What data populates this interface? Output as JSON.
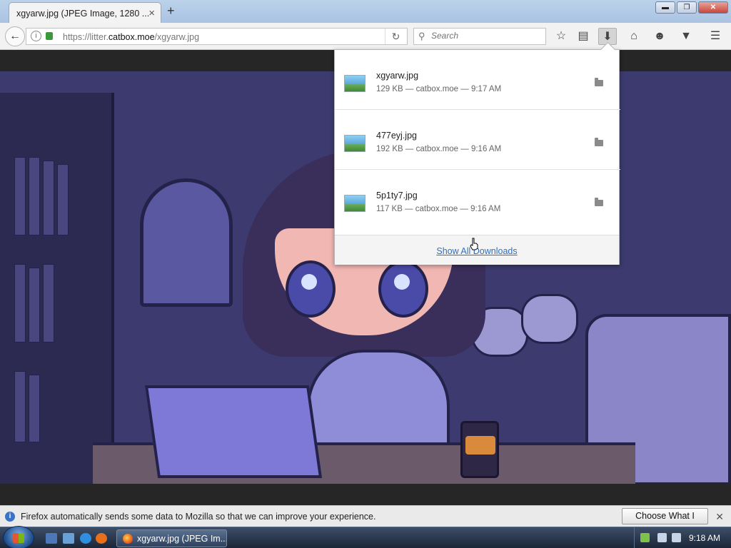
{
  "tab": {
    "title": "xgyarw.jpg (JPEG Image, 1280 ...",
    "close_glyph": "×"
  },
  "newtab_glyph": "+",
  "window_controls": {
    "minimize": "▬",
    "maximize": "❐",
    "close": "✕"
  },
  "nav": {
    "url_host_prefix": "https://litter.",
    "url_domain": "catbox.moe",
    "url_path": "/xgyarw.jpg",
    "search_placeholder": "Search",
    "icons": [
      "back-arrow-icon",
      "info-icon",
      "lock-icon",
      "reload-icon",
      "search-icon",
      "bookmark-star-icon",
      "reading-list-icon",
      "downloads-icon",
      "home-icon",
      "hello-chat-icon",
      "pocket-icon",
      "menu-icon"
    ]
  },
  "downloads": {
    "items": [
      {
        "name": "xgyarw.jpg",
        "meta": "129 KB — catbox.moe — 9:17 AM"
      },
      {
        "name": "477eyj.jpg",
        "meta": "192 KB — catbox.moe — 9:16 AM"
      },
      {
        "name": "5p1ty7.jpg",
        "meta": "117 KB — catbox.moe — 9:16 AM"
      }
    ],
    "show_all": "Show All Downloads"
  },
  "notification": {
    "text": "Firefox automatically sends some data to Mozilla so that we can improve your experience.",
    "button": "Choose What I Share",
    "close_glyph": "✕",
    "info_glyph": "i"
  },
  "taskbar": {
    "active_window": "xgyarw.jpg (JPEG Im...",
    "clock": "9:18 AM"
  },
  "colors": {
    "link": "#2f6fbf",
    "tabstrip": "#a9c3e2",
    "artwork_base": "#3c3a6e"
  }
}
